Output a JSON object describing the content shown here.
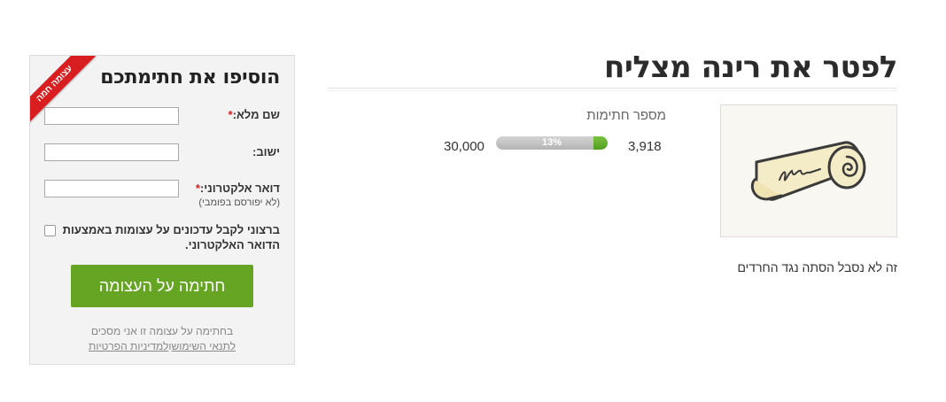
{
  "petition": {
    "title": "לפטר את רינה מצליח",
    "description": "זה לא נסבל הסתה נגד החרדים",
    "image_icon": "scroll-icon"
  },
  "signatures": {
    "label": "מספר חתימות",
    "count": "3,918",
    "goal": "30,000",
    "percent_label": "13%",
    "progress_fraction": 0.13
  },
  "form": {
    "title": "הוסיפו את חתימתכם",
    "ribbon": "עצומה חמה",
    "full_name_label": "שם מלא:",
    "required_mark": "*",
    "city_label": "ישוב:",
    "email_label": "דואר אלקטרוני:",
    "email_note": "(לא יפורסם בפומבי)",
    "updates_checkbox_label": "ברצוני לקבל עדכונים על עצומות באמצעות הדואר האלקטרוני.",
    "submit_label": "חתימה על העצומה",
    "terms_prefix": "בחתימה על עצומה זו אני מסכים",
    "terms_link_label": "לתנאי השימוש",
    "terms_and": "ו",
    "privacy_link_label": "למדיניות הפרטיות",
    "colors": {
      "button": "#65a523",
      "ribbon": "#d81e1e",
      "required": "#d81e1e",
      "progress": "#5aab25"
    }
  }
}
